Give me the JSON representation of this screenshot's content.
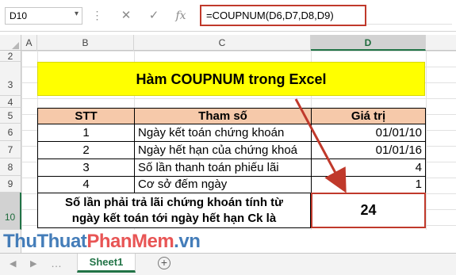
{
  "formula_bar": {
    "name_box": "D10",
    "cancel_icon": "✕",
    "enter_icon": "✓",
    "fx_label": "fx",
    "formula": "=COUPNUM(D6,D7,D8,D9)"
  },
  "columns": [
    "A",
    "B",
    "C",
    "D"
  ],
  "selected_column": "D",
  "rows": [
    "2",
    "3",
    "4",
    "5",
    "6",
    "7",
    "8",
    "9",
    "10"
  ],
  "selected_row": "10",
  "title": "Hàm COUPNUM trong Excel",
  "table": {
    "headers": [
      "STT",
      "Tham số",
      "Giá trị"
    ],
    "rows": [
      {
        "stt": "1",
        "param": "Ngày kết toán chứng khoán",
        "value": "01/01/10"
      },
      {
        "stt": "2",
        "param": "Ngày hết hạn của chứng khoá",
        "value": "01/01/16"
      },
      {
        "stt": "3",
        "param": "Số lần thanh toán phiếu lãi",
        "value": "4"
      },
      {
        "stt": "4",
        "param": "Cơ sở đếm ngày",
        "value": "1"
      }
    ]
  },
  "result": {
    "label_line1": "Số lần phải trả lãi chứng khoán tính từ",
    "label_line2": "ngày kết toán tới ngày hết hạn Ck là",
    "value": "24"
  },
  "sheet_tabs": {
    "active": "Sheet1",
    "add_icon": "+"
  },
  "watermark": {
    "part1": "ThuThuat",
    "part2": "PhanMem",
    "part3": ".vn"
  },
  "colors": {
    "accent_red": "#c0392b",
    "header_fill": "#f6c9aa",
    "title_fill": "#ffff00",
    "excel_green": "#217346"
  }
}
